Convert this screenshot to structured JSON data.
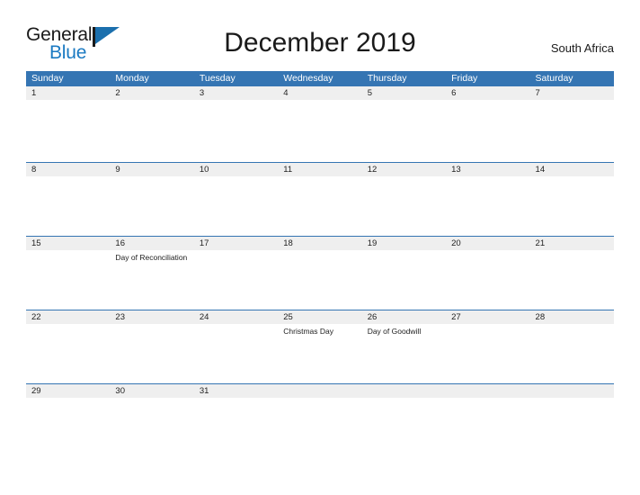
{
  "brand": {
    "name_part1": "General",
    "name_part2": "Blue",
    "flag_icon": "flag-triangle-icon",
    "accent_color": "#1b7ac2"
  },
  "header": {
    "title": "December 2019",
    "country": "South Africa"
  },
  "theme": {
    "header_blue": "#3575b3",
    "date_band_gray": "#efefef",
    "text_dark": "#222222"
  },
  "calendar": {
    "weekday_headers": [
      "Sunday",
      "Monday",
      "Tuesday",
      "Wednesday",
      "Thursday",
      "Friday",
      "Saturday"
    ],
    "weeks": [
      {
        "body_height": 69,
        "days": [
          {
            "num": "1",
            "events": []
          },
          {
            "num": "2",
            "events": []
          },
          {
            "num": "3",
            "events": []
          },
          {
            "num": "4",
            "events": []
          },
          {
            "num": "5",
            "events": []
          },
          {
            "num": "6",
            "events": []
          },
          {
            "num": "7",
            "events": []
          }
        ]
      },
      {
        "body_height": 66,
        "days": [
          {
            "num": "8",
            "events": []
          },
          {
            "num": "9",
            "events": []
          },
          {
            "num": "10",
            "events": []
          },
          {
            "num": "11",
            "events": []
          },
          {
            "num": "12",
            "events": []
          },
          {
            "num": "13",
            "events": []
          },
          {
            "num": "14",
            "events": []
          }
        ]
      },
      {
        "body_height": 66,
        "days": [
          {
            "num": "15",
            "events": []
          },
          {
            "num": "16",
            "events": [
              "Day of Reconciliation"
            ]
          },
          {
            "num": "17",
            "events": []
          },
          {
            "num": "18",
            "events": []
          },
          {
            "num": "19",
            "events": []
          },
          {
            "num": "20",
            "events": []
          },
          {
            "num": "21",
            "events": []
          }
        ]
      },
      {
        "body_height": 66,
        "days": [
          {
            "num": "22",
            "events": []
          },
          {
            "num": "23",
            "events": []
          },
          {
            "num": "24",
            "events": []
          },
          {
            "num": "25",
            "events": [
              "Christmas Day"
            ]
          },
          {
            "num": "26",
            "events": [
              "Day of Goodwill"
            ]
          },
          {
            "num": "27",
            "events": []
          },
          {
            "num": "28",
            "events": []
          }
        ]
      },
      {
        "body_height": 0,
        "days": [
          {
            "num": "29",
            "events": []
          },
          {
            "num": "30",
            "events": []
          },
          {
            "num": "31",
            "events": []
          },
          {
            "num": "",
            "events": []
          },
          {
            "num": "",
            "events": []
          },
          {
            "num": "",
            "events": []
          },
          {
            "num": "",
            "events": []
          }
        ]
      }
    ]
  }
}
